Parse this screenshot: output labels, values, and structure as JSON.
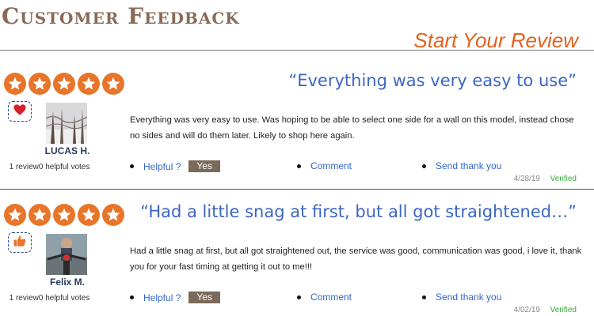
{
  "header": {
    "title": "Customer Feedback",
    "start_review": "Start Your Review"
  },
  "colors": {
    "title": "#8a6a58",
    "accent_orange": "#e8752a",
    "link_blue": "#3366cc",
    "verified_green": "#39a839",
    "yes_button": "#7b6a5a"
  },
  "reviews": [
    {
      "rating": 5,
      "headline": "“Everything was very easy to use”",
      "badge_icon": "heart-icon",
      "reviewer": "LUCAS H.",
      "votes": "1 review0 helpful votes",
      "body": "Everything was very easy to use. Was hoping to be able to select one side for a wall on this model, instead chose no sides and will do them later. Likely to shop here again.",
      "helpful_label": "Helpful ?",
      "yes_label": "Yes",
      "comment_label": "Comment",
      "thanks_label": "Send thank you",
      "date": "4/28/19",
      "verified": "Verified"
    },
    {
      "rating": 5,
      "headline": "“Had a little snag at first, but all got straightened…”",
      "badge_icon": "thumbs-up-icon",
      "reviewer": "Felix M.",
      "votes": "1 review0 helpful votes",
      "body": "Had a little snag at first, but all got straightened out, the service was good, communication was good, i love it, thank you for your fast timing at getting it out to me!!!",
      "helpful_label": "Helpful ?",
      "yes_label": "Yes",
      "comment_label": "Comment",
      "thanks_label": "Send thank you",
      "date": "4/02/19",
      "verified": "Verified"
    }
  ]
}
